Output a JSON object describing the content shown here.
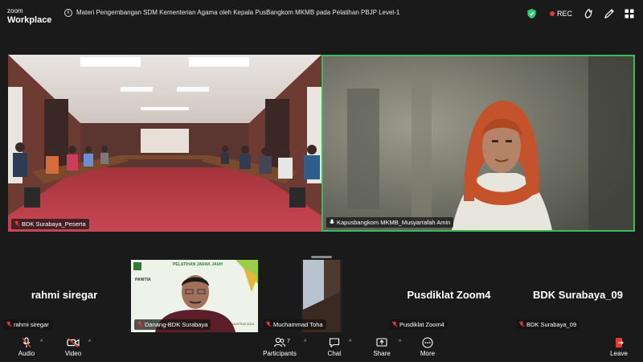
{
  "app": {
    "brand_line1": "zoom",
    "brand_line2": "Workplace"
  },
  "meeting": {
    "title": "Materi Pengembangan SDM Kementerian Agama oleh Kepala PusBangkom MKMB pada Pelatihan PBJP Level-1",
    "rec_label": "REC"
  },
  "video": {
    "room_name": "BDK Surabaya_Peserta",
    "speaker_name": "Kapusbangkom MKMB_Musyarrafah Amin"
  },
  "gallery": [
    {
      "display": "rahmi siregar",
      "tag": "rahmi siregar"
    },
    {
      "display": "",
      "tag": "Danang-BDK Surabaya",
      "slide_title": "PELATIHAN JARAK JAUH",
      "slide_sub": "PANITIA",
      "slide_date": "AGUSTUS 2024"
    },
    {
      "display": "",
      "tag": "Muchammad Toha"
    },
    {
      "display": "Pusdiklat Zoom4",
      "tag": "Pusdiklat Zoom4"
    },
    {
      "display": "BDK Surabaya_09",
      "tag": "BDK Surabaya_09"
    }
  ],
  "toolbar": {
    "audio": "Audio",
    "video": "Video",
    "participants": "Participants",
    "participants_count": "7",
    "chat": "Chat",
    "share": "Share",
    "more": "More",
    "leave": "Leave"
  },
  "colors": {
    "active_speaker": "#3dbb5a",
    "rec": "#e53935",
    "shield": "#2ecc71",
    "leave": "#e53935",
    "muted": "#e53935"
  }
}
